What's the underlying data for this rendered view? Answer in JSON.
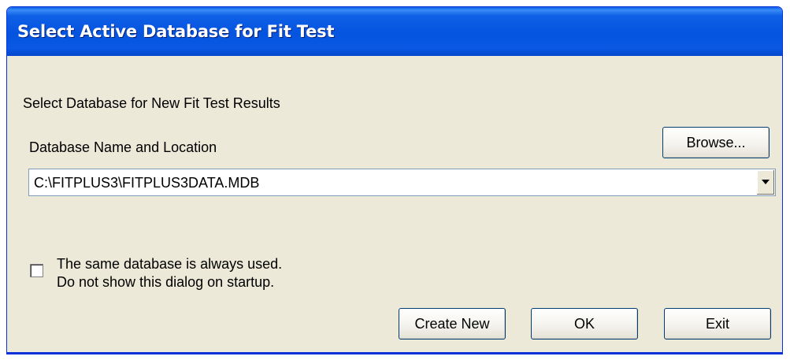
{
  "window": {
    "title": "Select Active Database for Fit Test"
  },
  "content": {
    "instruction": "Select Database for New Fit Test Results",
    "db_label": "Database Name and Location",
    "browse_label": "Browse...",
    "db_path": "C:\\FITPLUS3\\FITPLUS3DATA.MDB",
    "checkbox_line1": "The same database is always used.",
    "checkbox_line2": "Do not show this dialog on startup.",
    "checkbox_checked": false
  },
  "buttons": {
    "create_new": "Create New",
    "ok": "OK",
    "exit": "Exit"
  },
  "icons": {
    "combo_arrow": "chevron-down-icon"
  },
  "colors": {
    "titlebar": "#0554e0",
    "dialog_bg": "#ece9d8",
    "button_border": "#003c74"
  }
}
